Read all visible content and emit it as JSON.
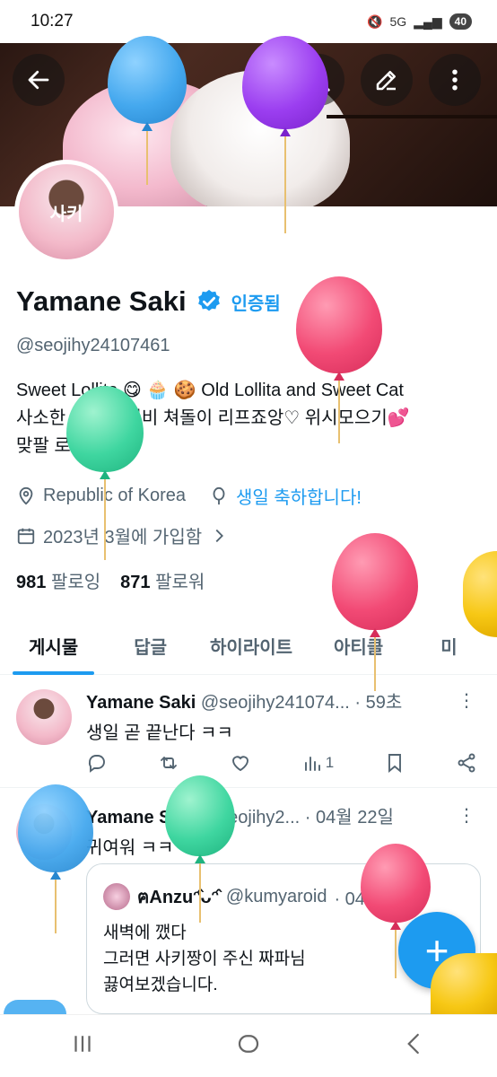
{
  "status_bar": {
    "time": "10:27",
    "network": "5G",
    "battery": "40"
  },
  "profile": {
    "name": "Yamane Saki",
    "verified_label": "인증됨",
    "handle": "@seojihy24107461",
    "avatar_text": "사키",
    "bio_lines": [
      "Sweet Lollita 😋 🧁 🍪  Old Lollita and Sweet Cat",
      "사소한 일상 베이비 쳐돌이 리프죠앙♡ 위시모으기💕",
      "맞팔 로리타만"
    ],
    "location": "Republic of Korea",
    "birthday": "생일 축하합니다!",
    "joined": "2023년 3월에 가입함",
    "following_count": "981",
    "following_label": "팔로잉",
    "followers_count": "871",
    "followers_label": "팔로워"
  },
  "tabs": [
    "게시물",
    "답글",
    "하이라이트",
    "아티클",
    "미"
  ],
  "posts": [
    {
      "name": "Yamane Saki",
      "handle": "@seojihy241074...",
      "time": "· 59초",
      "text": "생일 곧 끝난다 ㅋㅋ",
      "views": "1"
    },
    {
      "name": "Yamane Saki",
      "handle": "@seojihy2...",
      "time": "· 04월 22일",
      "text": "귀여워 ㅋㅋ",
      "quote": {
        "name": "ฅAnzuᵔ̂ᴗᵔ̂ ",
        "handle": "@kumyaroid",
        "time": "· 04월 22일",
        "lines": [
          "새벽에 깼다",
          "그러면 사키짱이 주신 짜파님",
          "끓여보겠습니다."
        ]
      }
    }
  ],
  "fab_label": "+",
  "colors": {
    "accent": "#1d9bf0",
    "text": "#0f1419",
    "muted": "#536471"
  },
  "icons": [
    "back-arrow-icon",
    "search-icon",
    "edit-icon",
    "more-vertical-icon",
    "verified-icon",
    "location-icon",
    "balloon-icon",
    "calendar-icon",
    "chevron-right-icon",
    "reply-icon",
    "retweet-icon",
    "like-icon",
    "views-icon",
    "bookmark-icon",
    "share-icon"
  ]
}
